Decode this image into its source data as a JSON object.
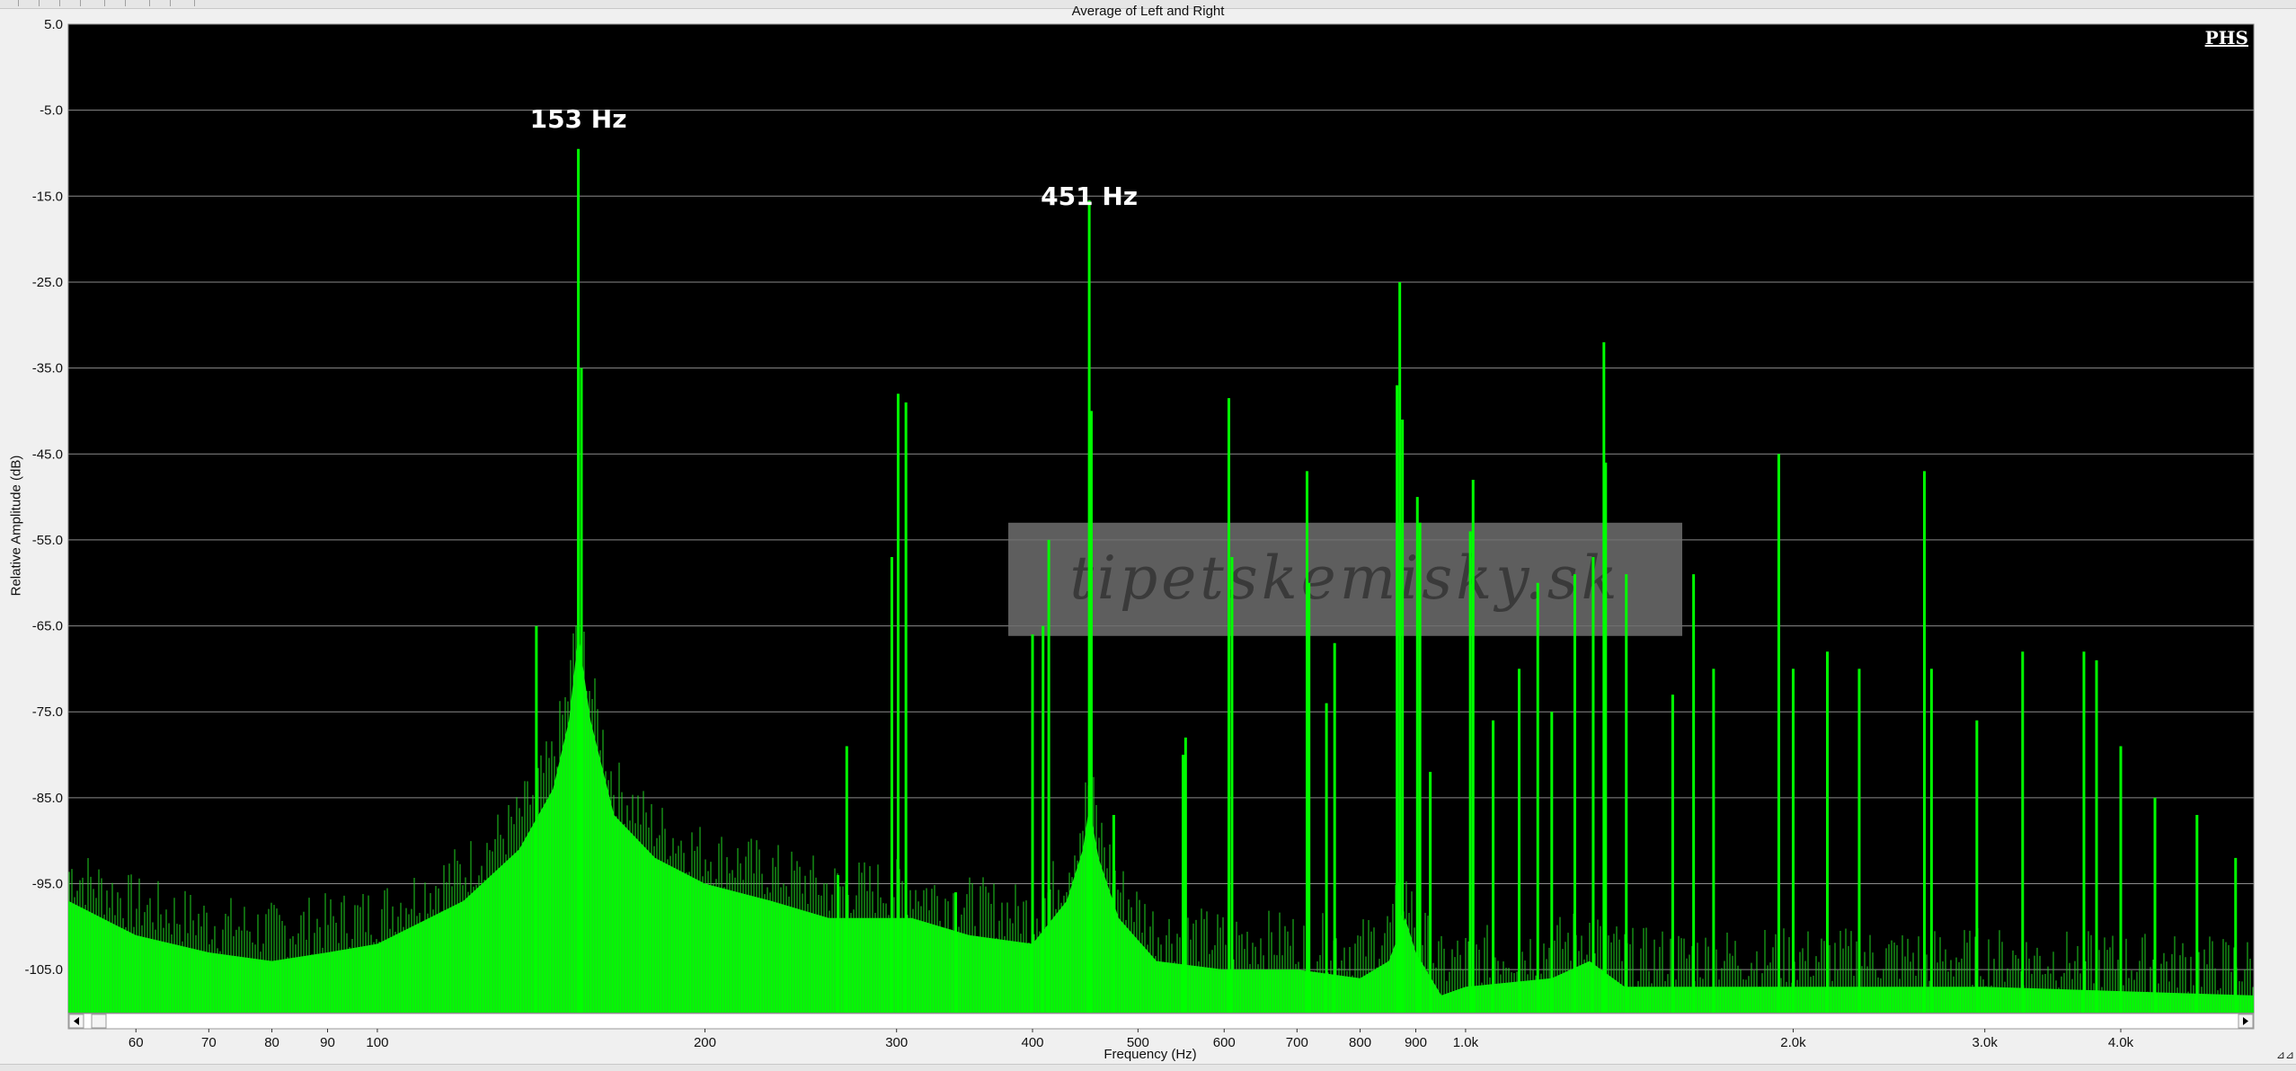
{
  "chart_data": {
    "type": "line",
    "title": "Average of Left and Right",
    "xlabel": "Frequency (Hz)",
    "ylabel": "Relative Amplitude (dB)",
    "x_scale": "log",
    "xlim": [
      52,
      5300
    ],
    "ylim": [
      -110,
      5
    ],
    "y_ticks": [
      "5.0",
      "-5.0",
      "-15.0",
      "-25.0",
      "-35.0",
      "-45.0",
      "-55.0",
      "-65.0",
      "-75.0",
      "-85.0",
      "-95.0",
      "-105.0"
    ],
    "x_ticks": [
      {
        "value": 60,
        "label": "60"
      },
      {
        "value": 70,
        "label": "70"
      },
      {
        "value": 80,
        "label": "80"
      },
      {
        "value": 90,
        "label": "90"
      },
      {
        "value": 100,
        "label": "100"
      },
      {
        "value": 200,
        "label": "200"
      },
      {
        "value": 300,
        "label": "300"
      },
      {
        "value": 400,
        "label": "400"
      },
      {
        "value": 500,
        "label": "500"
      },
      {
        "value": 600,
        "label": "600"
      },
      {
        "value": 700,
        "label": "700"
      },
      {
        "value": 800,
        "label": "800"
      },
      {
        "value": 900,
        "label": "900"
      },
      {
        "value": 1000,
        "label": "1.0k"
      },
      {
        "value": 2000,
        "label": "2.0k"
      },
      {
        "value": 3000,
        "label": "3.0k"
      },
      {
        "value": 4000,
        "label": "4.0k"
      }
    ],
    "grid": "horizontal",
    "background_color": "#000000",
    "grid_color": "#8a8a8a",
    "series_color": "#00ff00",
    "noise_floor": [
      {
        "x": 52,
        "y": -97
      },
      {
        "x": 60,
        "y": -101
      },
      {
        "x": 70,
        "y": -103
      },
      {
        "x": 80,
        "y": -104
      },
      {
        "x": 90,
        "y": -103
      },
      {
        "x": 100,
        "y": -102
      },
      {
        "x": 120,
        "y": -97
      },
      {
        "x": 135,
        "y": -91
      },
      {
        "x": 145,
        "y": -84
      },
      {
        "x": 150,
        "y": -76
      },
      {
        "x": 153,
        "y": -66
      },
      {
        "x": 157,
        "y": -76
      },
      {
        "x": 165,
        "y": -87
      },
      {
        "x": 180,
        "y": -92
      },
      {
        "x": 200,
        "y": -95
      },
      {
        "x": 230,
        "y": -97
      },
      {
        "x": 260,
        "y": -99
      },
      {
        "x": 290,
        "y": -99
      },
      {
        "x": 310,
        "y": -99
      },
      {
        "x": 350,
        "y": -101
      },
      {
        "x": 400,
        "y": -102
      },
      {
        "x": 430,
        "y": -97
      },
      {
        "x": 445,
        "y": -91
      },
      {
        "x": 451,
        "y": -86
      },
      {
        "x": 460,
        "y": -92
      },
      {
        "x": 480,
        "y": -99
      },
      {
        "x": 520,
        "y": -104
      },
      {
        "x": 600,
        "y": -105
      },
      {
        "x": 700,
        "y": -105
      },
      {
        "x": 800,
        "y": -106
      },
      {
        "x": 850,
        "y": -104
      },
      {
        "x": 880,
        "y": -99
      },
      {
        "x": 900,
        "y": -103
      },
      {
        "x": 950,
        "y": -108
      },
      {
        "x": 1000,
        "y": -107
      },
      {
        "x": 1200,
        "y": -106
      },
      {
        "x": 1300,
        "y": -104
      },
      {
        "x": 1400,
        "y": -107
      },
      {
        "x": 2000,
        "y": -107
      },
      {
        "x": 3000,
        "y": -107
      },
      {
        "x": 5300,
        "y": -108
      }
    ],
    "peaks": [
      {
        "x": 140,
        "y": -65
      },
      {
        "x": 153,
        "y": -9.5
      },
      {
        "x": 154,
        "y": -35
      },
      {
        "x": 265,
        "y": -94
      },
      {
        "x": 270,
        "y": -79
      },
      {
        "x": 297,
        "y": -57
      },
      {
        "x": 301,
        "y": -38
      },
      {
        "x": 306,
        "y": -39
      },
      {
        "x": 340,
        "y": -96
      },
      {
        "x": 400,
        "y": -66
      },
      {
        "x": 409,
        "y": -65
      },
      {
        "x": 414,
        "y": -55
      },
      {
        "x": 451,
        "y": -15.5
      },
      {
        "x": 453,
        "y": -40
      },
      {
        "x": 475,
        "y": -87
      },
      {
        "x": 550,
        "y": -80
      },
      {
        "x": 553,
        "y": -78
      },
      {
        "x": 606,
        "y": -38.5
      },
      {
        "x": 610,
        "y": -57
      },
      {
        "x": 715,
        "y": -47
      },
      {
        "x": 718,
        "y": -60
      },
      {
        "x": 745,
        "y": -74
      },
      {
        "x": 758,
        "y": -67
      },
      {
        "x": 865,
        "y": -37
      },
      {
        "x": 870,
        "y": -25
      },
      {
        "x": 875,
        "y": -41
      },
      {
        "x": 903,
        "y": -50
      },
      {
        "x": 908,
        "y": -53
      },
      {
        "x": 928,
        "y": -82
      },
      {
        "x": 1010,
        "y": -54
      },
      {
        "x": 1016,
        "y": -48
      },
      {
        "x": 1060,
        "y": -76
      },
      {
        "x": 1120,
        "y": -70
      },
      {
        "x": 1165,
        "y": -60
      },
      {
        "x": 1200,
        "y": -75
      },
      {
        "x": 1260,
        "y": -59
      },
      {
        "x": 1310,
        "y": -57
      },
      {
        "x": 1340,
        "y": -32
      },
      {
        "x": 1345,
        "y": -46
      },
      {
        "x": 1405,
        "y": -59
      },
      {
        "x": 1550,
        "y": -73
      },
      {
        "x": 1620,
        "y": -59
      },
      {
        "x": 1690,
        "y": -70
      },
      {
        "x": 1940,
        "y": -45
      },
      {
        "x": 2000,
        "y": -70
      },
      {
        "x": 2150,
        "y": -68
      },
      {
        "x": 2300,
        "y": -70
      },
      {
        "x": 2640,
        "y": -47
      },
      {
        "x": 2680,
        "y": -70
      },
      {
        "x": 2950,
        "y": -76
      },
      {
        "x": 3250,
        "y": -68
      },
      {
        "x": 3700,
        "y": -68
      },
      {
        "x": 3800,
        "y": -69
      },
      {
        "x": 4000,
        "y": -79
      },
      {
        "x": 4300,
        "y": -85
      },
      {
        "x": 4700,
        "y": -87
      },
      {
        "x": 5100,
        "y": -92
      }
    ],
    "annotations": [
      {
        "x": 153,
        "y": -7,
        "text": "153 Hz"
      },
      {
        "x": 451,
        "y": -16,
        "text": "451 Hz"
      }
    ],
    "logo_text": "PHS",
    "watermark_text": "tipetskemisky.sk"
  },
  "ui": {
    "scroll_left_icon": "triangle-left-icon",
    "scroll_right_icon": "triangle-right-icon"
  }
}
